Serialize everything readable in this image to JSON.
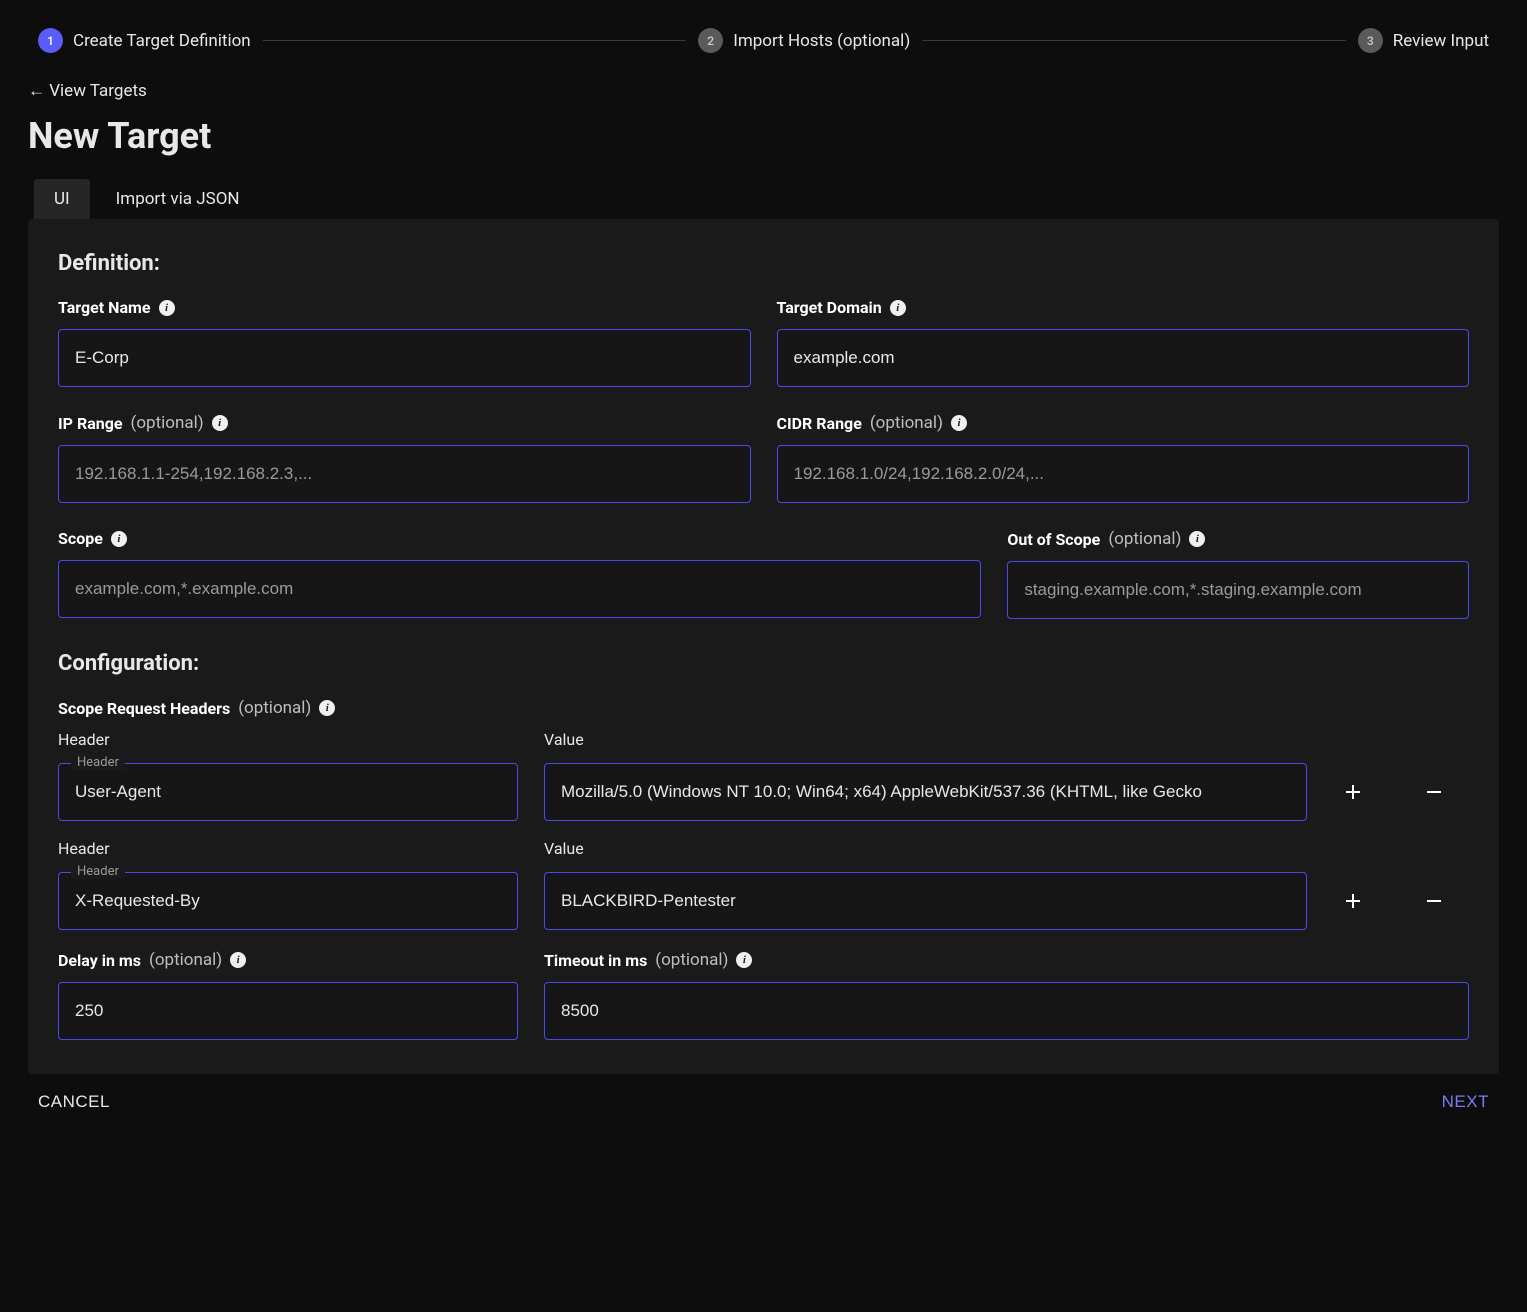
{
  "stepper": {
    "steps": [
      {
        "num": "1",
        "label": "Create Target Definition",
        "active": true
      },
      {
        "num": "2",
        "label": "Import Hosts (optional)",
        "active": false
      },
      {
        "num": "3",
        "label": "Review Input",
        "active": false
      }
    ]
  },
  "back_link": "← View Targets",
  "page_title": "New Target",
  "tabs": [
    {
      "label": "UI",
      "active": true
    },
    {
      "label": "Import via JSON",
      "active": false
    }
  ],
  "definition": {
    "title": "Definition:",
    "target_name": {
      "label": "Target Name",
      "value": "E-Corp"
    },
    "target_domain": {
      "label": "Target Domain",
      "value": "example.com"
    },
    "ip_range": {
      "label": "IP Range",
      "optional": "(optional)",
      "placeholder": "192.168.1.1-254,192.168.2.3,..."
    },
    "cidr_range": {
      "label": "CIDR Range",
      "optional": "(optional)",
      "placeholder": "192.168.1.0/24,192.168.2.0/24,..."
    },
    "scope": {
      "label": "Scope",
      "placeholder": "example.com,*.example.com"
    },
    "out_of_scope": {
      "label": "Out of Scope",
      "optional": "(optional)",
      "placeholder": "staging.example.com,*.staging.example.com"
    }
  },
  "configuration": {
    "title": "Configuration:",
    "headers_label": "Scope Request Headers",
    "headers_optional": "(optional)",
    "header_col": "Header",
    "value_col": "Value",
    "legend": "Header",
    "rows": [
      {
        "header": "User-Agent",
        "value": "Mozilla/5.0 (Windows NT 10.0; Win64; x64) AppleWebKit/537.36 (KHTML, like Gecko"
      },
      {
        "header": "X-Requested-By",
        "value": "BLACKBIRD-Pentester"
      }
    ],
    "delay": {
      "label": "Delay in ms",
      "optional": "(optional)",
      "value": "250"
    },
    "timeout": {
      "label": "Timeout in ms",
      "optional": "(optional)",
      "value": "8500"
    }
  },
  "footer": {
    "cancel": "CANCEL",
    "next": "NEXT"
  }
}
